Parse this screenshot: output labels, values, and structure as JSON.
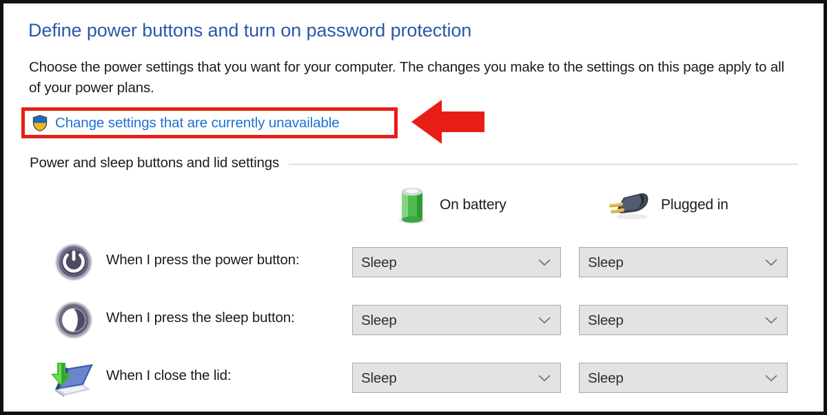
{
  "page": {
    "title": "Define power buttons and turn on password protection",
    "intro": "Choose the power settings that you want for your computer. The changes you make to the settings on this page apply to all of your power plans.",
    "uac_link": "Change settings that are currently unavailable",
    "uac_icon": "uac-shield-icon",
    "section_header": "Power and sleep buttons and lid settings"
  },
  "columns": [
    {
      "label": "On battery",
      "icon": "battery-icon"
    },
    {
      "label": "Plugged in",
      "icon": "power-plug-icon"
    }
  ],
  "rows": [
    {
      "icon": "power-button-icon",
      "label": "When I press the power button:",
      "on_battery": "Sleep",
      "plugged_in": "Sleep"
    },
    {
      "icon": "sleep-button-icon",
      "label": "When I press the sleep button:",
      "on_battery": "Sleep",
      "plugged_in": "Sleep"
    },
    {
      "icon": "laptop-lid-icon",
      "label": "When I close the lid:",
      "on_battery": "Sleep",
      "plugged_in": "Sleep"
    }
  ],
  "annotations": {
    "highlight_color": "#e81d16",
    "arrow_color": "#e81d16",
    "arrow_direction": "left",
    "link_color": "#1f6fd0",
    "title_color": "#2a58a8"
  }
}
